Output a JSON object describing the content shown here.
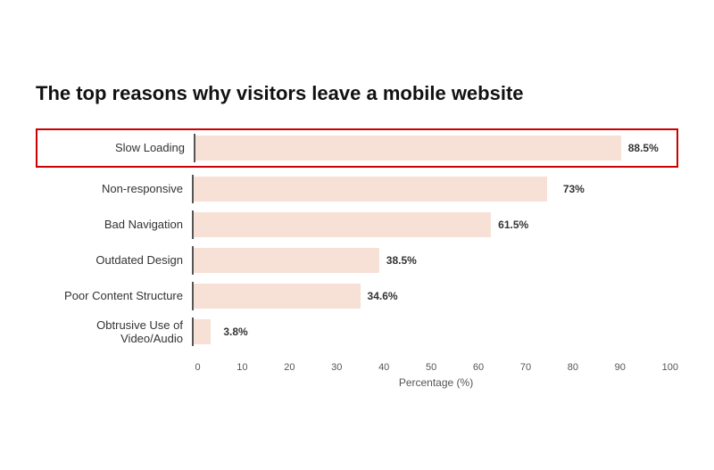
{
  "chart": {
    "title": "The top reasons why visitors leave a mobile website",
    "bars": [
      {
        "label": "Slow Loading",
        "value": 88.5,
        "display": "88.5%",
        "highlighted": true
      },
      {
        "label": "Non-responsive",
        "value": 73,
        "display": "73%",
        "highlighted": false
      },
      {
        "label": "Bad Navigation",
        "value": 61.5,
        "display": "61.5%",
        "highlighted": false
      },
      {
        "label": "Outdated Design",
        "value": 38.5,
        "display": "38.5%",
        "highlighted": false
      },
      {
        "label": "Poor Content Structure",
        "value": 34.6,
        "display": "34.6%",
        "highlighted": false
      },
      {
        "label": "Obtrusive Use of Video/Audio",
        "value": 3.8,
        "display": "3.8%",
        "highlighted": false
      }
    ],
    "x_axis": {
      "ticks": [
        "0",
        "10",
        "20",
        "30",
        "40",
        "50",
        "60",
        "70",
        "80",
        "90",
        "100"
      ],
      "label": "Percentage (%)"
    }
  }
}
